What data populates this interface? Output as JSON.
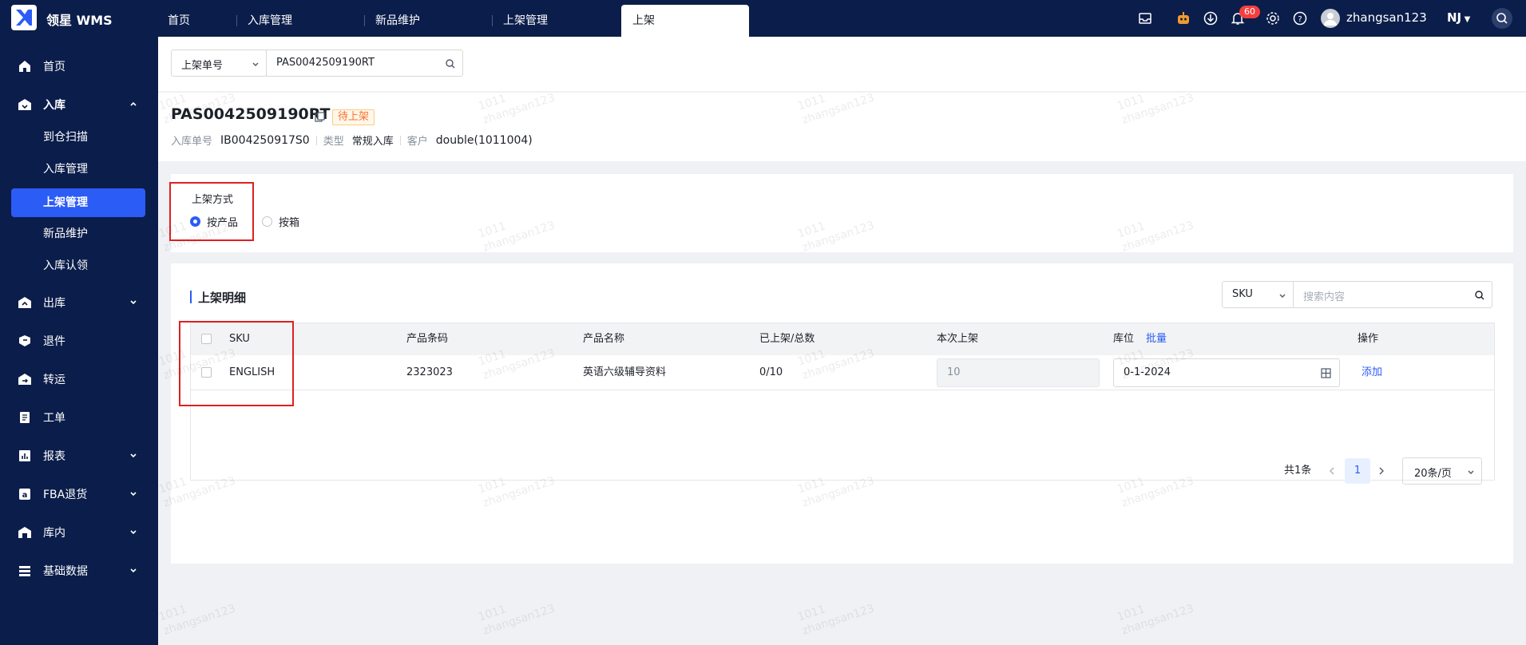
{
  "header": {
    "brand": "领星 WMS",
    "tabs": [
      "首页",
      "入库管理",
      "新品维护",
      "上架管理",
      "上架"
    ],
    "notification_count": "60",
    "username": "zhangsan123",
    "warehouse": "NJ"
  },
  "sidebar": {
    "items": [
      {
        "label": "首页",
        "icon": "home-icon"
      },
      {
        "label": "入库",
        "icon": "inbound-icon"
      },
      {
        "label": "出库",
        "icon": "outbound-icon"
      },
      {
        "label": "退件",
        "icon": "return-icon"
      },
      {
        "label": "转运",
        "icon": "transfer-icon"
      },
      {
        "label": "工单",
        "icon": "workorder-icon"
      },
      {
        "label": "报表",
        "icon": "report-icon"
      },
      {
        "label": "FBA退货",
        "icon": "amazon-icon"
      },
      {
        "label": "库内",
        "icon": "warehouse-icon"
      },
      {
        "label": "基础数据",
        "icon": "data-icon"
      }
    ],
    "subitems": [
      "到仓扫描",
      "入库管理",
      "上架管理",
      "新品维护",
      "入库认领"
    ]
  },
  "search": {
    "field_select": "上架单号",
    "value": "PAS0042509190RT"
  },
  "order": {
    "number": "PAS0042509190RT",
    "status": "待上架",
    "inbound_label": "入库单号",
    "inbound_value": "IB004250917S0",
    "type_label": "类型",
    "type_value": "常规入库",
    "customer_label": "客户",
    "customer_value": "double(1011004)"
  },
  "mode": {
    "title": "上架方式",
    "options": [
      "按产品",
      "按箱"
    ],
    "selected": "按产品"
  },
  "detail": {
    "title": "上架明细",
    "filter_select": "SKU",
    "search_placeholder": "搜索内容",
    "columns": [
      "SKU",
      "产品条码",
      "产品名称",
      "已上架/总数",
      "本次上架",
      "库位",
      "操作"
    ],
    "batch_label": "批量",
    "rows": [
      {
        "sku": "ENGLISH",
        "barcode": "2323023",
        "name": "英语六级辅导资料",
        "progress": "0/10",
        "qty": "10",
        "location": "0-1-2024",
        "action": "添加"
      }
    ]
  },
  "pagination": {
    "total": "共1条",
    "page": "1",
    "page_size": "20条/页"
  },
  "watermark": {
    "line1": "1011",
    "line2": "zhangsan123"
  }
}
